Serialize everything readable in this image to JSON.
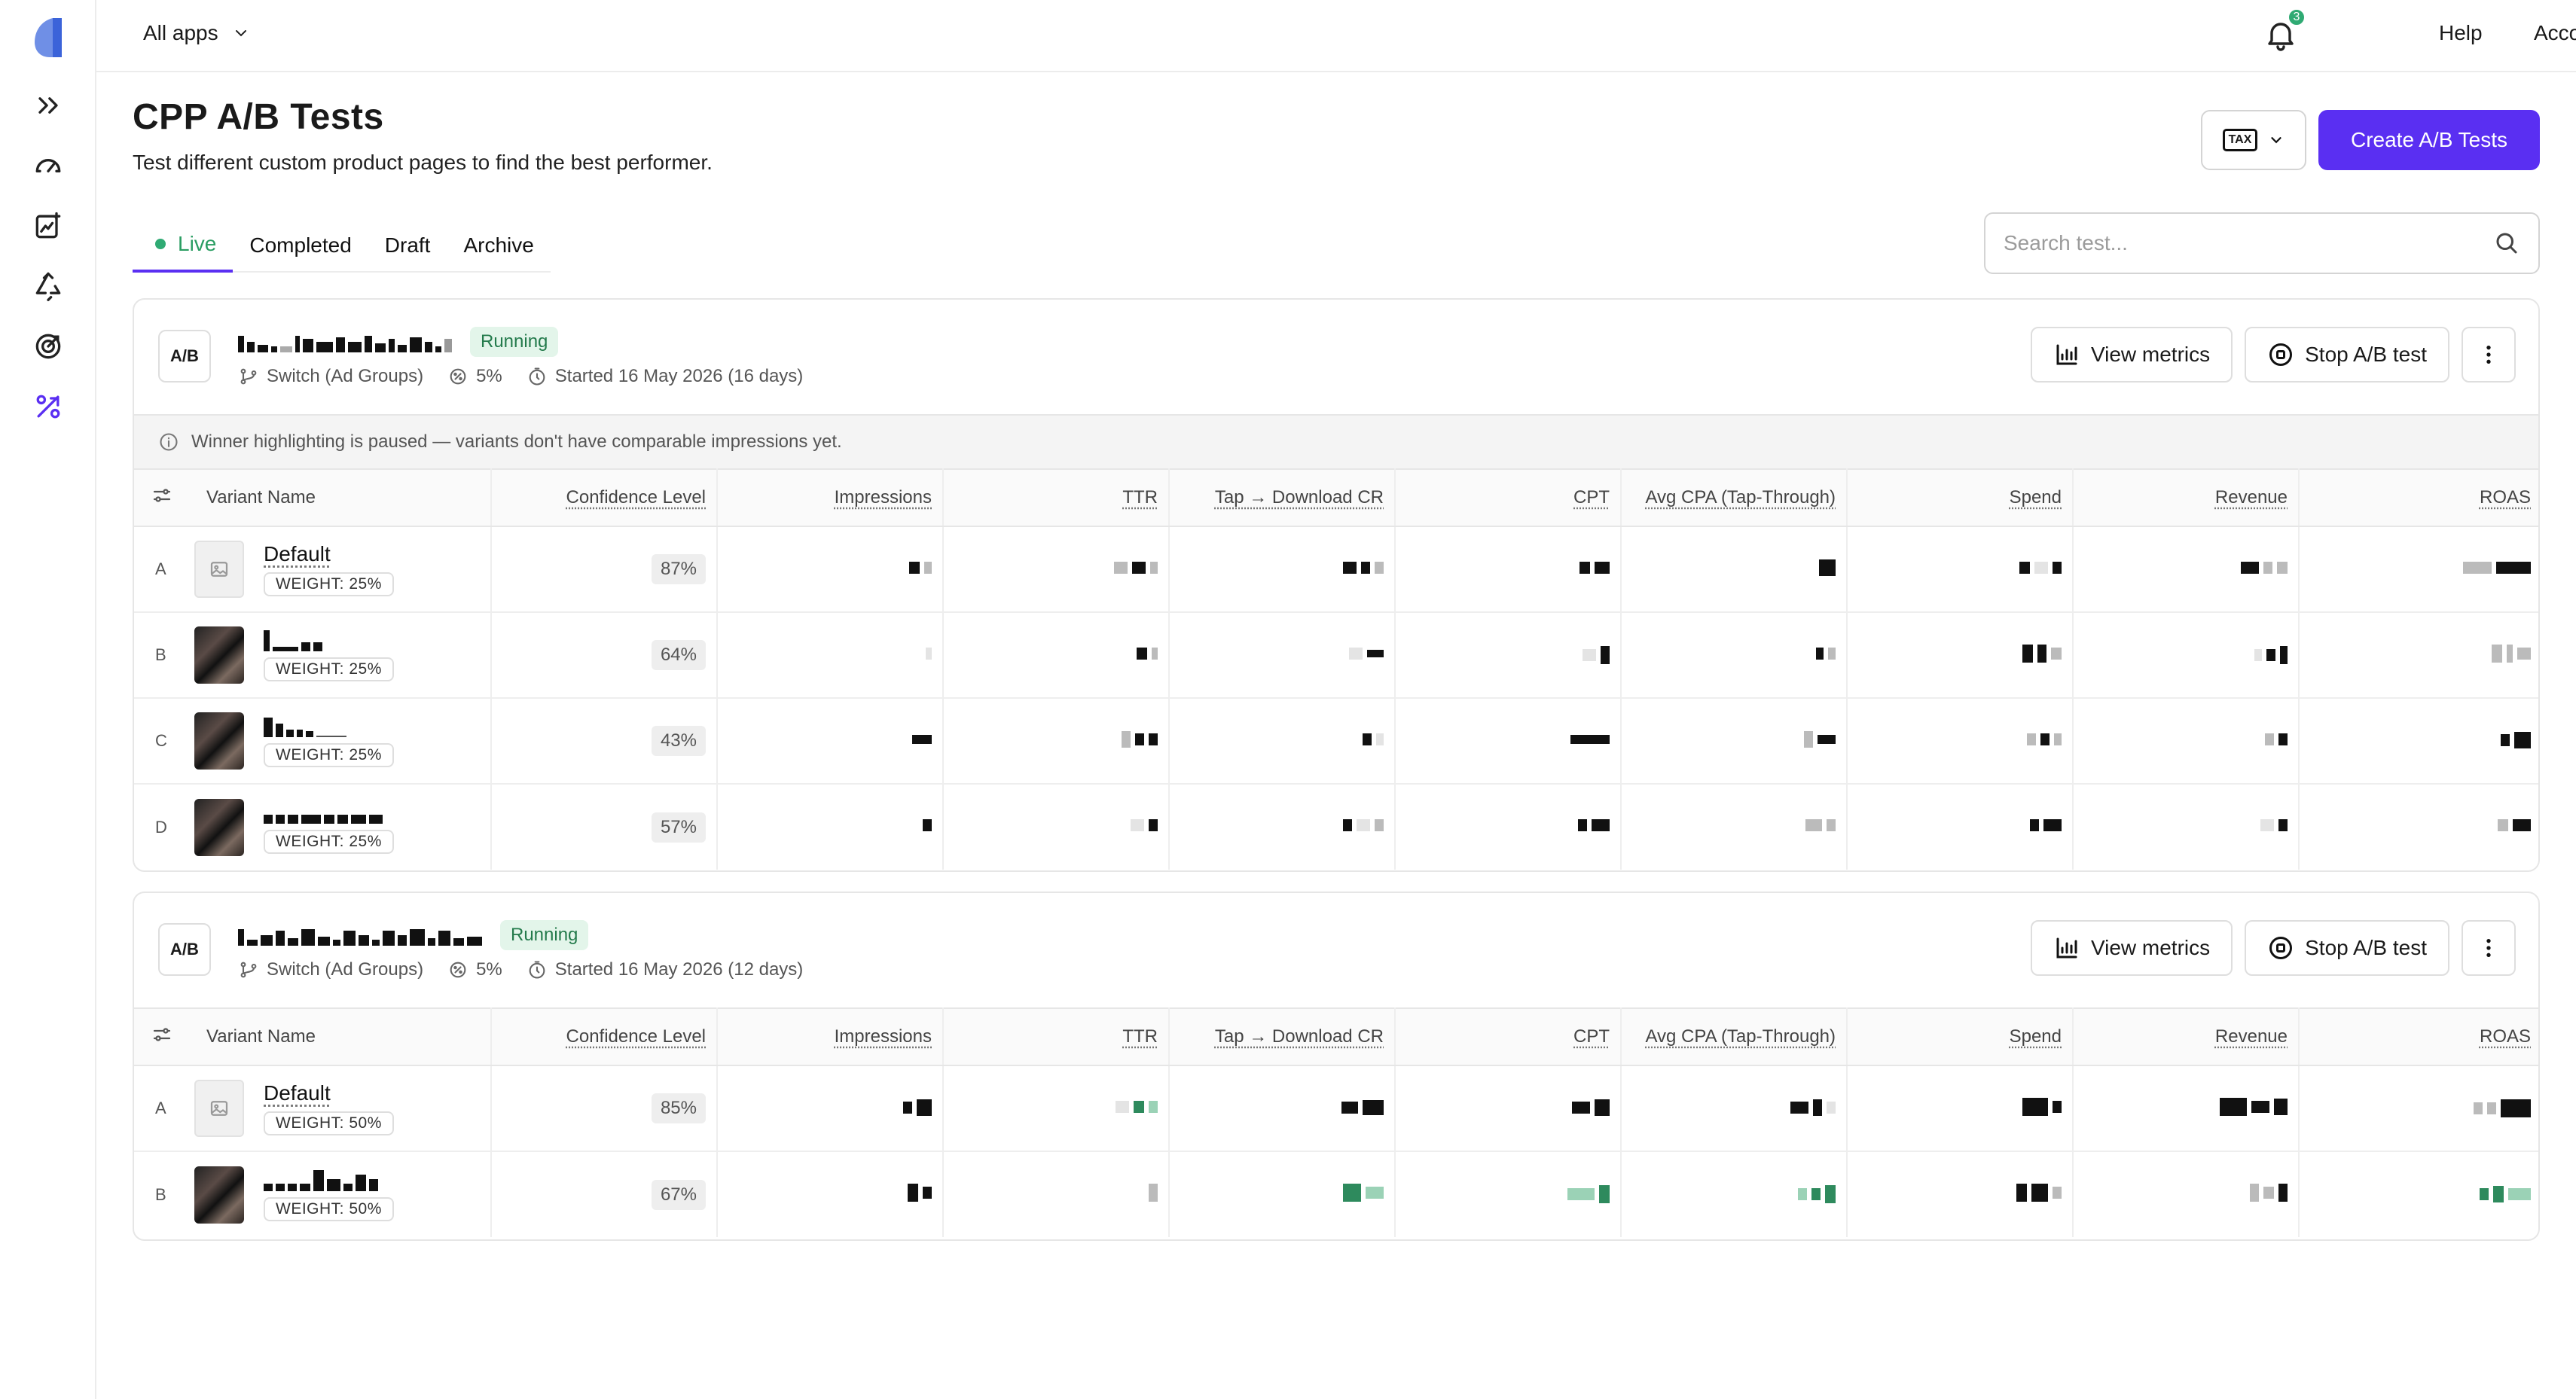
{
  "nav": {
    "app_selector": "All apps",
    "notification_count": "3",
    "help": "Help",
    "account": "Account"
  },
  "header": {
    "title": "CPP A/B Tests",
    "subtitle": "Test different custom product pages to find the best performer.",
    "tax_label": "TAX",
    "create_button": "Create A/B Tests"
  },
  "tabs": [
    {
      "label": "Live",
      "active": true
    },
    {
      "label": "Completed"
    },
    {
      "label": "Draft"
    },
    {
      "label": "Archive"
    }
  ],
  "search": {
    "placeholder": "Search test..."
  },
  "columns": [
    "Variant Name",
    "Confidence Level",
    "Impressions",
    "TTR",
    "Tap → Download CR",
    "CPT",
    "Avg CPA (Tap-Through)",
    "Spend",
    "Revenue",
    "ROAS"
  ],
  "tests": [
    {
      "ab_label": "A/B",
      "status": "Running",
      "source": "Switch (Ad Groups)",
      "traffic": "5%",
      "started": "Started 16 May 2026 (16 days)",
      "view_metrics": "View metrics",
      "stop": "Stop A/B test",
      "notice": "Winner highlighting is paused — variants don't have comparable impressions yet.",
      "variants": [
        {
          "letter": "A",
          "name": "Default",
          "weight": "WEIGHT: 25%",
          "confidence": "87%"
        },
        {
          "letter": "B",
          "name": "",
          "weight": "WEIGHT: 25%",
          "confidence": "64%"
        },
        {
          "letter": "C",
          "name": "",
          "weight": "WEIGHT: 25%",
          "confidence": "43%"
        },
        {
          "letter": "D",
          "name": "",
          "weight": "WEIGHT: 25%",
          "confidence": "57%"
        }
      ]
    },
    {
      "ab_label": "A/B",
      "status": "Running",
      "source": "Switch (Ad Groups)",
      "traffic": "5%",
      "started": "Started 16 May 2026 (12 days)",
      "view_metrics": "View metrics",
      "stop": "Stop A/B test",
      "variants": [
        {
          "letter": "A",
          "name": "Default",
          "weight": "WEIGHT: 50%",
          "confidence": "85%"
        },
        {
          "letter": "B",
          "name": "",
          "weight": "WEIGHT: 50%",
          "confidence": "67%"
        }
      ]
    }
  ],
  "colors": {
    "accent": "#5a2ff2",
    "live": "#2faa73",
    "running_bg": "#e3f5ea",
    "running_text": "#237a4b"
  }
}
